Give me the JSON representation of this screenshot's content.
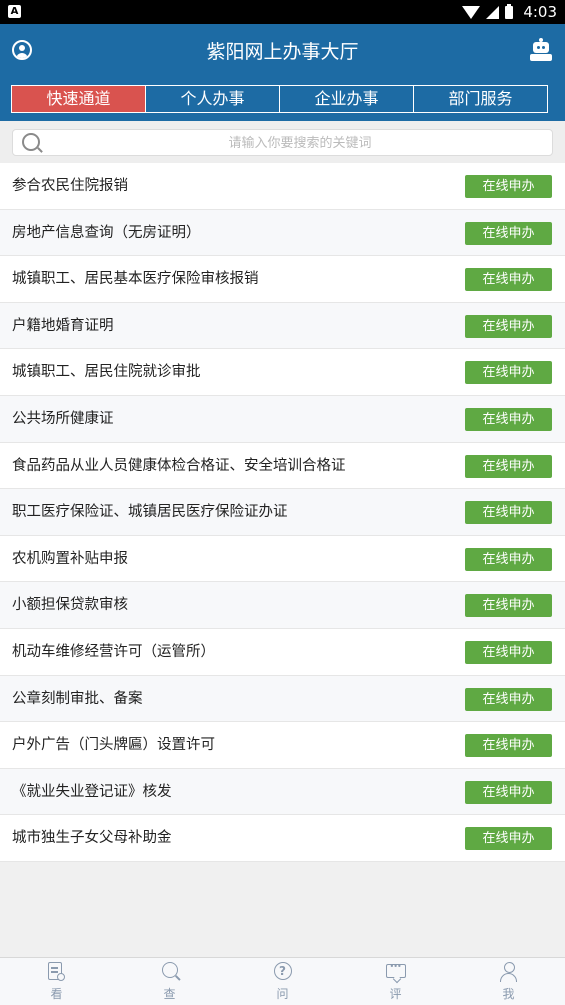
{
  "status_bar": {
    "time": "4:03",
    "left_icon": "A"
  },
  "header": {
    "title": "紫阳网上办事大厅",
    "left_icon": "user-icon",
    "right_icon": "robot-icon"
  },
  "tabs": [
    {
      "label": "快速通道",
      "active": true
    },
    {
      "label": "个人办事",
      "active": false
    },
    {
      "label": "企业办事",
      "active": false
    },
    {
      "label": "部门服务",
      "active": false
    }
  ],
  "search": {
    "placeholder": "请输入你要搜索的关键词",
    "value": ""
  },
  "items": [
    {
      "label": "参合农民住院报销",
      "action": "在线申办"
    },
    {
      "label": "房地产信息查询（无房证明）",
      "action": "在线申办"
    },
    {
      "label": "城镇职工、居民基本医疗保险审核报销",
      "action": "在线申办"
    },
    {
      "label": "户籍地婚育证明",
      "action": "在线申办"
    },
    {
      "label": "城镇职工、居民住院就诊审批",
      "action": "在线申办"
    },
    {
      "label": "公共场所健康证",
      "action": "在线申办"
    },
    {
      "label": "食品药品从业人员健康体检合格证、安全培训合格证",
      "action": "在线申办"
    },
    {
      "label": "职工医疗保险证、城镇居民医疗保险证办证",
      "action": "在线申办"
    },
    {
      "label": "农机购置补贴申报",
      "action": "在线申办"
    },
    {
      "label": "小额担保贷款审核",
      "action": "在线申办"
    },
    {
      "label": "机动车维修经营许可（运管所）",
      "action": "在线申办"
    },
    {
      "label": "公章刻制审批、备案",
      "action": "在线申办"
    },
    {
      "label": "户外广告（门头牌匾）设置许可",
      "action": "在线申办"
    },
    {
      "label": "《就业失业登记证》核发",
      "action": "在线申办"
    },
    {
      "label": "城市独生子女父母补助金",
      "action": "在线申办"
    }
  ],
  "bottom_nav": [
    {
      "label": "看",
      "icon": "document-search-icon"
    },
    {
      "label": "查",
      "icon": "search-icon"
    },
    {
      "label": "问",
      "icon": "question-icon"
    },
    {
      "label": "评",
      "icon": "comment-icon"
    },
    {
      "label": "我",
      "icon": "user-icon"
    }
  ],
  "colors": {
    "header": "#1d6ba4",
    "active_tab": "#d9534f",
    "button": "#5fa943"
  }
}
